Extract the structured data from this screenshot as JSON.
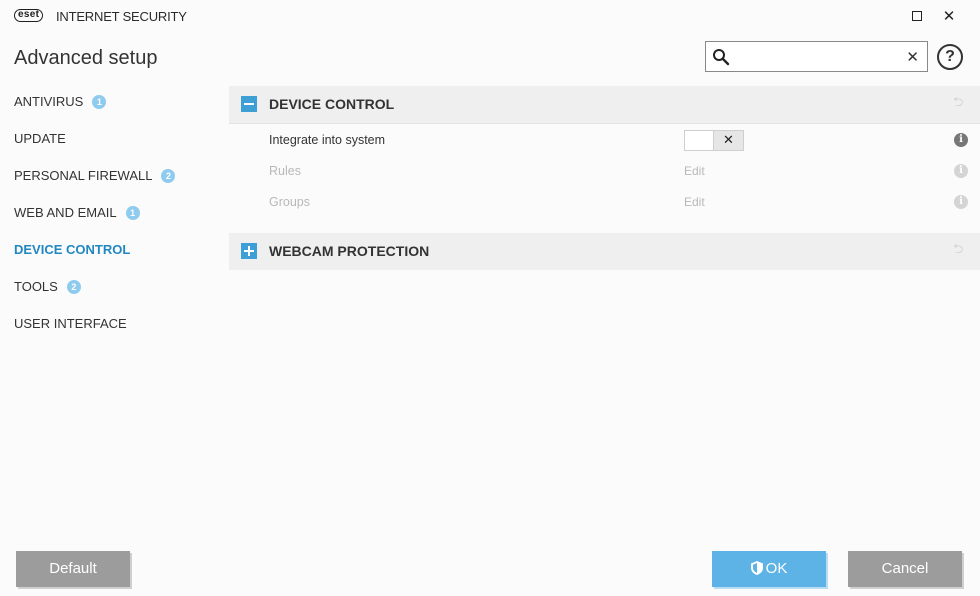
{
  "window": {
    "logo_text": "eset",
    "product_name": "INTERNET SECURITY",
    "maximize_label": "",
    "close_label": "✕"
  },
  "header": {
    "title": "Advanced setup",
    "search": {
      "value": "",
      "placeholder": ""
    },
    "help_label": "?"
  },
  "sidebar": {
    "items": [
      {
        "label": "ANTIVIRUS",
        "badge": "1"
      },
      {
        "label": "UPDATE",
        "badge": ""
      },
      {
        "label": "PERSONAL FIREWALL",
        "badge": "2"
      },
      {
        "label": "WEB AND EMAIL",
        "badge": "1"
      },
      {
        "label": "DEVICE CONTROL",
        "badge": "",
        "active": true
      },
      {
        "label": "TOOLS",
        "badge": "2"
      },
      {
        "label": "USER INTERFACE",
        "badge": ""
      }
    ]
  },
  "main": {
    "sections": [
      {
        "title": "DEVICE CONTROL",
        "expanded": true,
        "settings": [
          {
            "label": "Integrate into system",
            "control": "toggle",
            "toggle_state": "off",
            "toggle_glyph": "✕"
          },
          {
            "label": "Rules",
            "control": "link",
            "link_text": "Edit"
          },
          {
            "label": "Groups",
            "control": "link",
            "link_text": "Edit"
          }
        ]
      },
      {
        "title": "WEBCAM PROTECTION",
        "expanded": false
      }
    ]
  },
  "footer": {
    "default_label": "Default",
    "ok_label": "OK",
    "cancel_label": "Cancel"
  },
  "colors": {
    "accent": "#2187c2",
    "badge": "#8fcbef",
    "ok_button": "#5db3e6",
    "gray_button": "#9c9c9c"
  },
  "icons": {
    "search": "search-icon",
    "clear": "close-icon",
    "help": "help-icon",
    "section_collapse": "minus-icon",
    "section_expand": "plus-icon",
    "revert": "revert-icon",
    "info": "info-icon",
    "ok": "shield-icon"
  }
}
